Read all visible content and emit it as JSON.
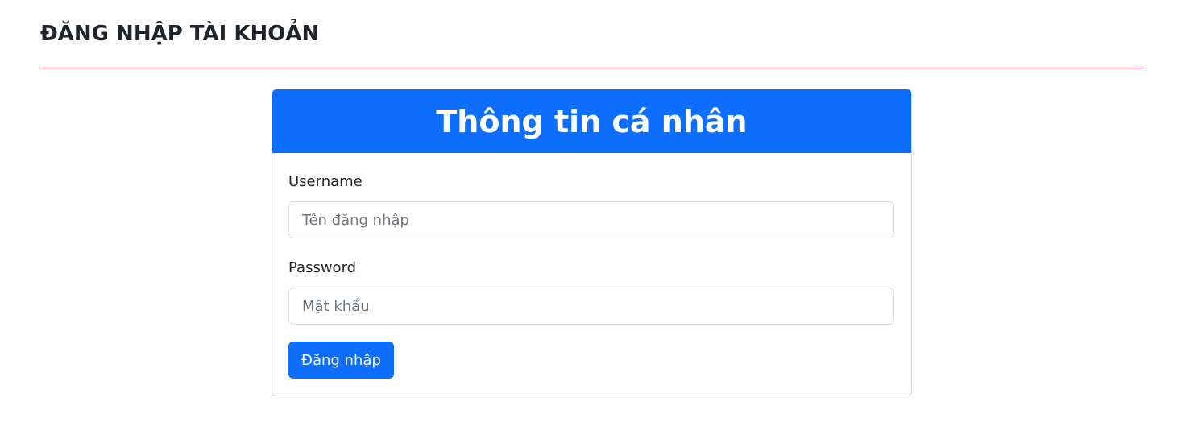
{
  "page": {
    "title": "ĐĂNG NHẬP TÀI KHOẢN",
    "divider_color": "#dc3545"
  },
  "card": {
    "header_title": "Thông tin cá nhân",
    "header_color": "#0d6efd",
    "username_label": "Username",
    "username_placeholder": "Tên đăng nhập",
    "username_value": "",
    "password_label": "Password",
    "password_placeholder": "Mật khẩu",
    "password_value": "",
    "submit_label": "Đăng nhập"
  }
}
